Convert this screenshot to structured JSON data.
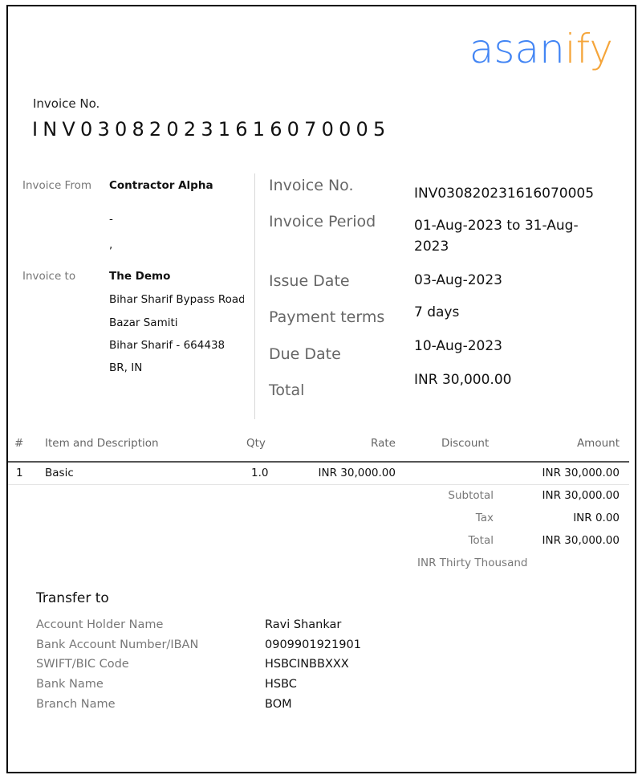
{
  "brand": {
    "logo_part1": "asan",
    "logo_part2": "ify",
    "colors": {
      "blue": "#4285f4",
      "orange": "#f5a53a"
    }
  },
  "header": {
    "invoice_no_label": "Invoice No.",
    "invoice_no_value": "INV030820231616070005"
  },
  "parties": {
    "from_label": "Invoice From",
    "from_name": "Contractor Alpha",
    "from_line1": "-",
    "from_line2": ",",
    "to_label": "Invoice to",
    "to_name": "The Demo",
    "to_lines": [
      "Bihar Sharif Bypass Road",
      "Bazar Samiti",
      "Bihar Sharif - 664438",
      "BR, IN"
    ]
  },
  "meta": [
    {
      "label": "Invoice No.",
      "value": "INV030820231616070005"
    },
    {
      "label": "Invoice Period",
      "value": "01-Aug-2023 to 31-Aug-2023"
    },
    {
      "label": "Issue Date",
      "value": "03-Aug-2023"
    },
    {
      "label": "Payment terms",
      "value": "7 days"
    },
    {
      "label": "Due Date",
      "value": "10-Aug-2023"
    },
    {
      "label": "Total",
      "value": "INR 30,000.00"
    }
  ],
  "table": {
    "headers": {
      "num": "#",
      "item": "Item and Description",
      "qty": "Qty",
      "rate": "Rate",
      "discount": "Discount",
      "amount": "Amount"
    },
    "rows": [
      {
        "num": "1",
        "item": "Basic",
        "qty": "1.0",
        "rate": "INR 30,000.00",
        "discount": "",
        "amount": "INR 30,000.00"
      }
    ]
  },
  "summary": {
    "subtotal_label": "Subtotal",
    "subtotal_value": "INR 30,000.00",
    "tax_label": "Tax",
    "tax_value": "INR 0.00",
    "total_label": "Total",
    "total_value": "INR 30,000.00",
    "amount_in_words": "INR Thirty Thousand"
  },
  "transfer": {
    "title": "Transfer to",
    "fields": [
      {
        "label": "Account Holder Name",
        "value": "Ravi Shankar"
      },
      {
        "label": "Bank Account Number/IBAN",
        "value": "0909901921901"
      },
      {
        "label": "SWIFT/BIC Code",
        "value": "HSBCINBBXXX"
      },
      {
        "label": "Bank Name",
        "value": "HSBC"
      },
      {
        "label": "Branch Name",
        "value": "BOM"
      }
    ]
  }
}
